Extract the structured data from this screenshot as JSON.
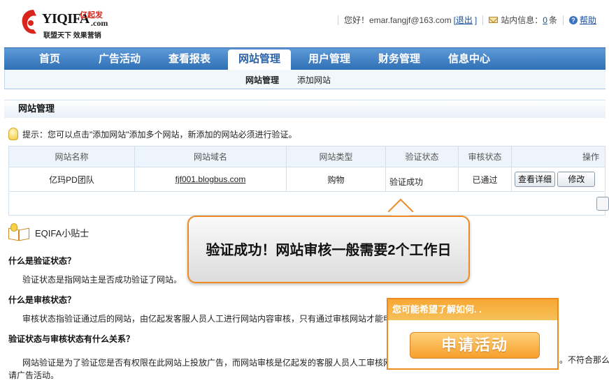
{
  "brand": {
    "name": "YIQIFA",
    "name_cn": "亿起发",
    "domain": ".com",
    "slogan": "联盟天下 效果营销",
    "accent": "#d9261c"
  },
  "topbar": {
    "greeting": "您好！",
    "email": "emar.fangjf@163.com",
    "logout_open": "[",
    "logout": "退出",
    "logout_close": "]",
    "inbox_label": "站内信息：",
    "inbox_count": "0",
    "inbox_unit": "条",
    "help": "帮助"
  },
  "nav": {
    "items": [
      "首页",
      "广告活动",
      "查看报表",
      "网站管理",
      "用户管理",
      "财务管理",
      "信息中心"
    ],
    "active_index": 3,
    "color": "#2f6fb5"
  },
  "subnav": {
    "items": [
      "网站管理",
      "添加网站"
    ]
  },
  "section": {
    "title": "网站管理",
    "tip": "提示：您可以点击\"添加网站\"添加多个网站，新添加的网站必须进行验证。"
  },
  "table": {
    "headers": [
      "网站名称",
      "网站域名",
      "网站类型",
      "验证状态",
      "审核状态",
      "操作"
    ],
    "rows": [
      {
        "name": "亿玛PD团队",
        "domain": "fjf001.blogbus.com",
        "type": "购物",
        "verify_status": "验证成功",
        "review_status": "已通过",
        "actions": [
          "查看详细",
          "修改"
        ]
      }
    ]
  },
  "tips": {
    "title": "EQIFA小贴士",
    "faq": [
      {
        "q": "什么是验证状态？",
        "a": "验证状态是指网站主是否成功验证了网站。"
      },
      {
        "q": "什么是审核状态？",
        "a": "审核状态指验证通过后的网站，由亿起发客服人员人工进行网站内容审核，只有通过审核网站才能申"
      },
      {
        "q": "验证状态与审核状态有什么关系？",
        "a": "网站验证是为了验证您是否有权限在此网站上投放广告，而网站审核是亿起发的客服人员人工审核网",
        "a2": "请广告活动。"
      }
    ],
    "tail_text": "。不符合那么"
  },
  "callout": {
    "text": "验证成功！网站审核一般需要2个工作日",
    "border": "#ee8a22"
  },
  "promo": {
    "header": "您可能希望了解如何. .",
    "button": "申请活动"
  }
}
